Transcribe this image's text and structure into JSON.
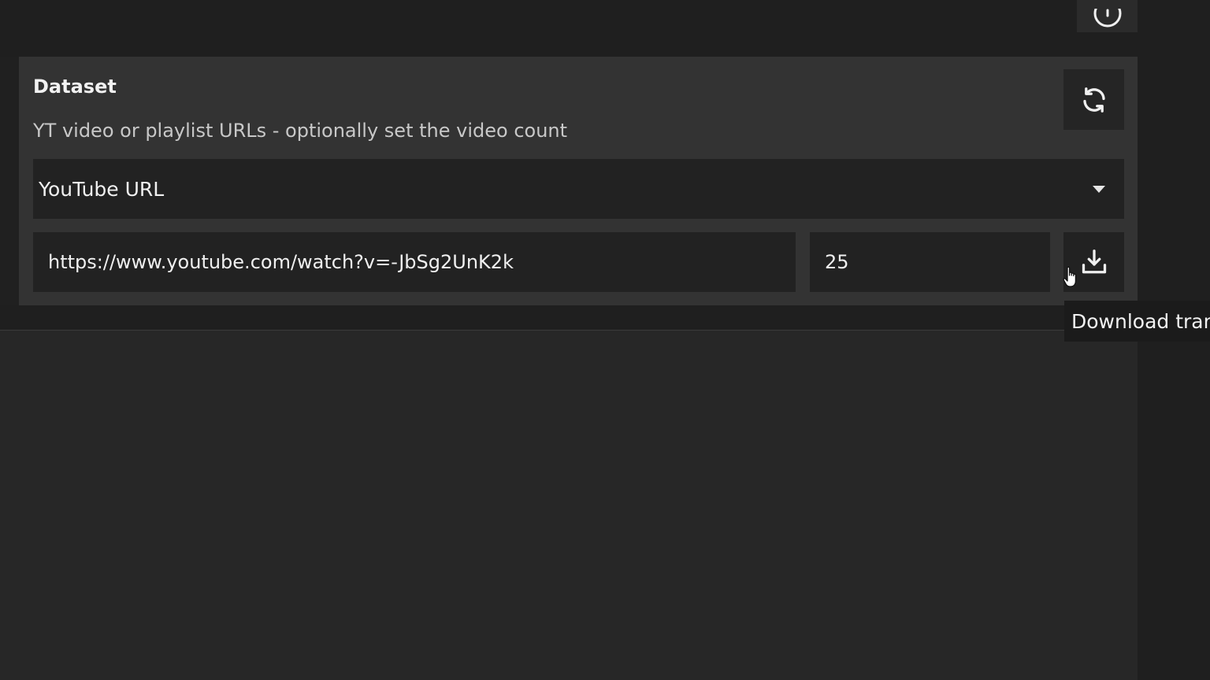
{
  "dataset_panel": {
    "title": "Dataset",
    "description": "YT video or playlist URLs - optionally set the video count",
    "source_select": {
      "selected": "YouTube URL"
    },
    "url_input": {
      "value": "https://www.youtube.com/watch?v=-JbSg2UnK2k"
    },
    "count_input": {
      "value": "25"
    },
    "refresh_icon": "refresh-icon",
    "download_icon": "download-icon"
  },
  "tooltip": {
    "text": "Download tran"
  },
  "top_icon": "info-icon"
}
